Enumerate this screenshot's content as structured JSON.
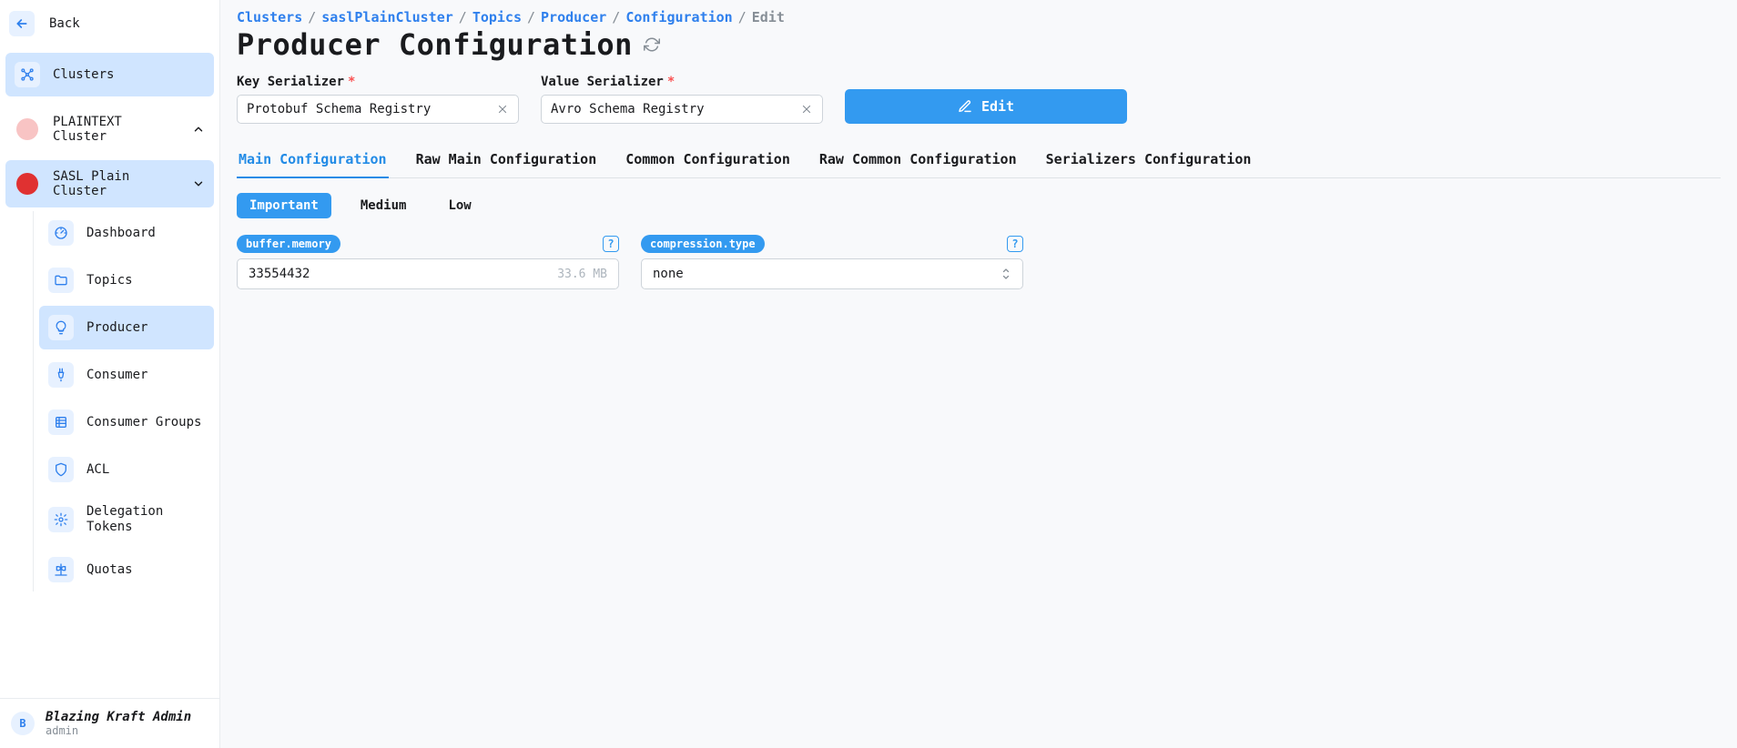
{
  "sidebar": {
    "back_label": "Back",
    "clusters_label": "Clusters",
    "cluster1_label": "PLAINTEXT Cluster",
    "cluster2_label": "SASL Plain Cluster",
    "subnav": {
      "dashboard": "Dashboard",
      "topics": "Topics",
      "producer": "Producer",
      "consumer": "Consumer",
      "consumer_groups": "Consumer Groups",
      "acl": "ACL",
      "delegation_tokens": "Delegation Tokens",
      "quotas": "Quotas"
    }
  },
  "user": {
    "initial": "B",
    "name": "Blazing Kraft Admin",
    "sub": "admin"
  },
  "breadcrumbs": {
    "clusters": "Clusters",
    "cluster_code": "saslPlainCluster",
    "topics": "Topics",
    "producer": "Producer",
    "configuration": "Configuration",
    "edit": "Edit"
  },
  "page_title": "Producer Configuration",
  "fields": {
    "key_serializer_label": "Key Serializer",
    "key_serializer_value": "Protobuf Schema Registry",
    "value_serializer_label": "Value Serializer",
    "value_serializer_value": "Avro Schema Registry",
    "edit_button": "Edit"
  },
  "tabs": {
    "main": "Main Configuration",
    "raw_main": "Raw Main Configuration",
    "common": "Common Configuration",
    "raw_common": "Raw Common Configuration",
    "serializers": "Serializers Configuration"
  },
  "importance": {
    "important": "Important",
    "medium": "Medium",
    "low": "Low"
  },
  "config": {
    "buffer_memory": {
      "key": "buffer.memory",
      "value": "33554432",
      "human": "33.6 MB"
    },
    "compression_type": {
      "key": "compression.type",
      "value": "none"
    }
  }
}
